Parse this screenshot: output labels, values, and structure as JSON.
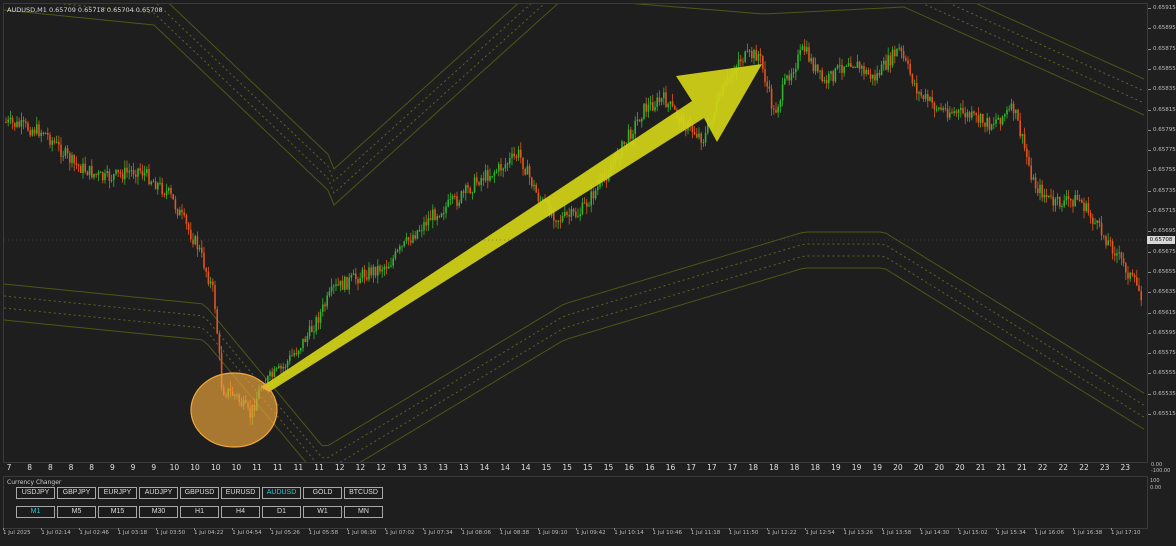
{
  "chart": {
    "symbol_info": "AUDUSD,M1  0.65709 0.65718 0.65704 0.65708",
    "current_price": "0.65708",
    "price_ticks": [
      "0.65915",
      "0.65895",
      "0.65875",
      "0.65855",
      "0.65835",
      "0.65815",
      "0.65795",
      "0.65775",
      "0.65755",
      "0.65735",
      "0.65715",
      "0.65695",
      "0.65675",
      "0.65655",
      "0.65635",
      "0.65615",
      "0.65595",
      "0.65575",
      "0.65555",
      "0.65535",
      "0.65515"
    ],
    "hour_labels": [
      "7",
      "8",
      "8",
      "8",
      "8",
      "9",
      "9",
      "9",
      "10",
      "10",
      "10",
      "10",
      "11",
      "11",
      "11",
      "11",
      "12",
      "12",
      "12",
      "13",
      "13",
      "13",
      "13",
      "14",
      "14",
      "14",
      "15",
      "15",
      "15",
      "15",
      "16",
      "16",
      "16",
      "17",
      "17",
      "17",
      "18",
      "18",
      "18",
      "18",
      "19",
      "19",
      "19",
      "20",
      "20",
      "20",
      "20",
      "21",
      "21",
      "21",
      "22",
      "22",
      "22",
      "23",
      "23"
    ],
    "time_ticks": [
      "1 Jul 2025",
      "1 Jul 02:14",
      "1 Jul 02:46",
      "1 Jul 03:18",
      "1 Jul 03:50",
      "1 Jul 04:22",
      "1 Jul 04:54",
      "1 Jul 05:26",
      "1 Jul 05:58",
      "1 Jul 06:30",
      "1 Jul 07:02",
      "1 Jul 07:34",
      "1 Jul 08:06",
      "1 Jul 08:38",
      "1 Jul 09:10",
      "1 Jul 09:42",
      "1 Jul 10:14",
      "1 Jul 10:46",
      "1 Jul 11:18",
      "1 Jul 11:50",
      "1 Jul 12:22",
      "1 Jul 12:54",
      "1 Jul 13:26",
      "1 Jul 13:58",
      "1 Jul 14:30",
      "1 Jul 15:02",
      "1 Jul 15:34",
      "1 Jul 16:06",
      "1 Jul 16:38",
      "1 Jul 17:10"
    ],
    "axis_corner": [
      "0.00",
      "-100.00"
    ],
    "colors": {
      "bull": "#2fb52f",
      "bear": "#e2561e",
      "band": "#4d5716",
      "band_dotted": "#5c6624",
      "arrow": "#d4d417",
      "circle": "#f2a83a"
    }
  },
  "panel": {
    "title": "Currency Changer",
    "pairs": [
      {
        "label": "USDJPY",
        "active": false
      },
      {
        "label": "GBPJPY",
        "active": false
      },
      {
        "label": "EURJPY",
        "active": false
      },
      {
        "label": "AUDJPY",
        "active": false
      },
      {
        "label": "GBPUSD",
        "active": false
      },
      {
        "label": "EURUSD",
        "active": false
      },
      {
        "label": "AUDUSD",
        "active": true
      },
      {
        "label": "GOLD",
        "active": false
      },
      {
        "label": "BTCUSD",
        "active": false
      }
    ],
    "timeframes": [
      {
        "label": "M1",
        "active": true
      },
      {
        "label": "M5",
        "active": false
      },
      {
        "label": "M15",
        "active": false
      },
      {
        "label": "M30",
        "active": false
      },
      {
        "label": "H1",
        "active": false
      },
      {
        "label": "H4",
        "active": false
      },
      {
        "label": "D1",
        "active": false
      },
      {
        "label": "W1",
        "active": false
      },
      {
        "label": "MN",
        "active": false
      }
    ],
    "axis": [
      "100",
      "0.00"
    ]
  }
}
